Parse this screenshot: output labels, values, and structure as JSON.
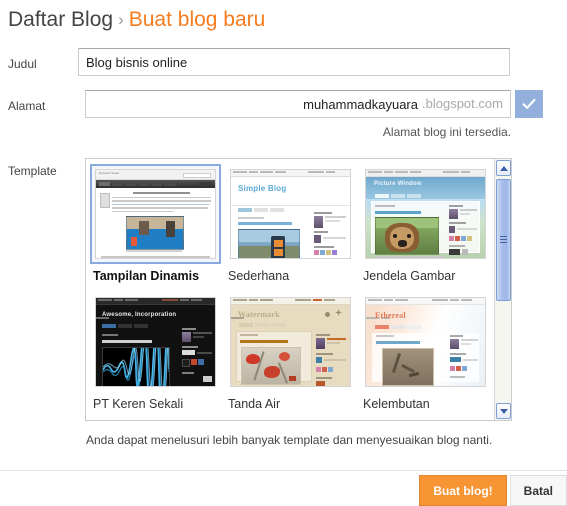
{
  "breadcrumb": {
    "root": "Daftar Blog",
    "separator": "›",
    "current": "Buat blog baru"
  },
  "form": {
    "title": {
      "label": "Judul",
      "value": "Blog bisnis online",
      "placeholder": ""
    },
    "address": {
      "label": "Alamat",
      "value": "muhammadkayuara",
      "suffix": ".blogspot.com",
      "placeholder": "",
      "check_icon": "check-icon",
      "check_button_color": "#93b0dd",
      "status": "Alamat blog ini tersedia."
    }
  },
  "template": {
    "label": "Template",
    "help_text": "Anda dapat menelusuri lebih banyak template dan menyesuaikan blog nanti.",
    "selected_index": 0,
    "selection_color": "#8aaadd",
    "items": [
      {
        "name": "Tampilan Dinamis",
        "preview_title": "Dynamic Views",
        "selected": true
      },
      {
        "name": "Sederhana",
        "preview_title": "Simple Blog",
        "selected": false
      },
      {
        "name": "Jendela Gambar",
        "preview_title": "Picture Window",
        "selected": false
      },
      {
        "name": "PT Keren Sekali",
        "preview_title": "Awesome, Incorporation",
        "selected": false
      },
      {
        "name": "Tanda Air",
        "preview_title": "Watermark",
        "selected": false
      },
      {
        "name": "Kelembutan",
        "preview_title": "Ethereal",
        "selected": false
      }
    ],
    "scrollbar": {
      "up_icon": "chevron-up-icon",
      "down_icon": "chevron-down-icon",
      "thumb_color": "#a7bdea"
    }
  },
  "footer": {
    "create_label": "Buat blog!",
    "create_color": "#f79433",
    "cancel_label": "Batal"
  }
}
